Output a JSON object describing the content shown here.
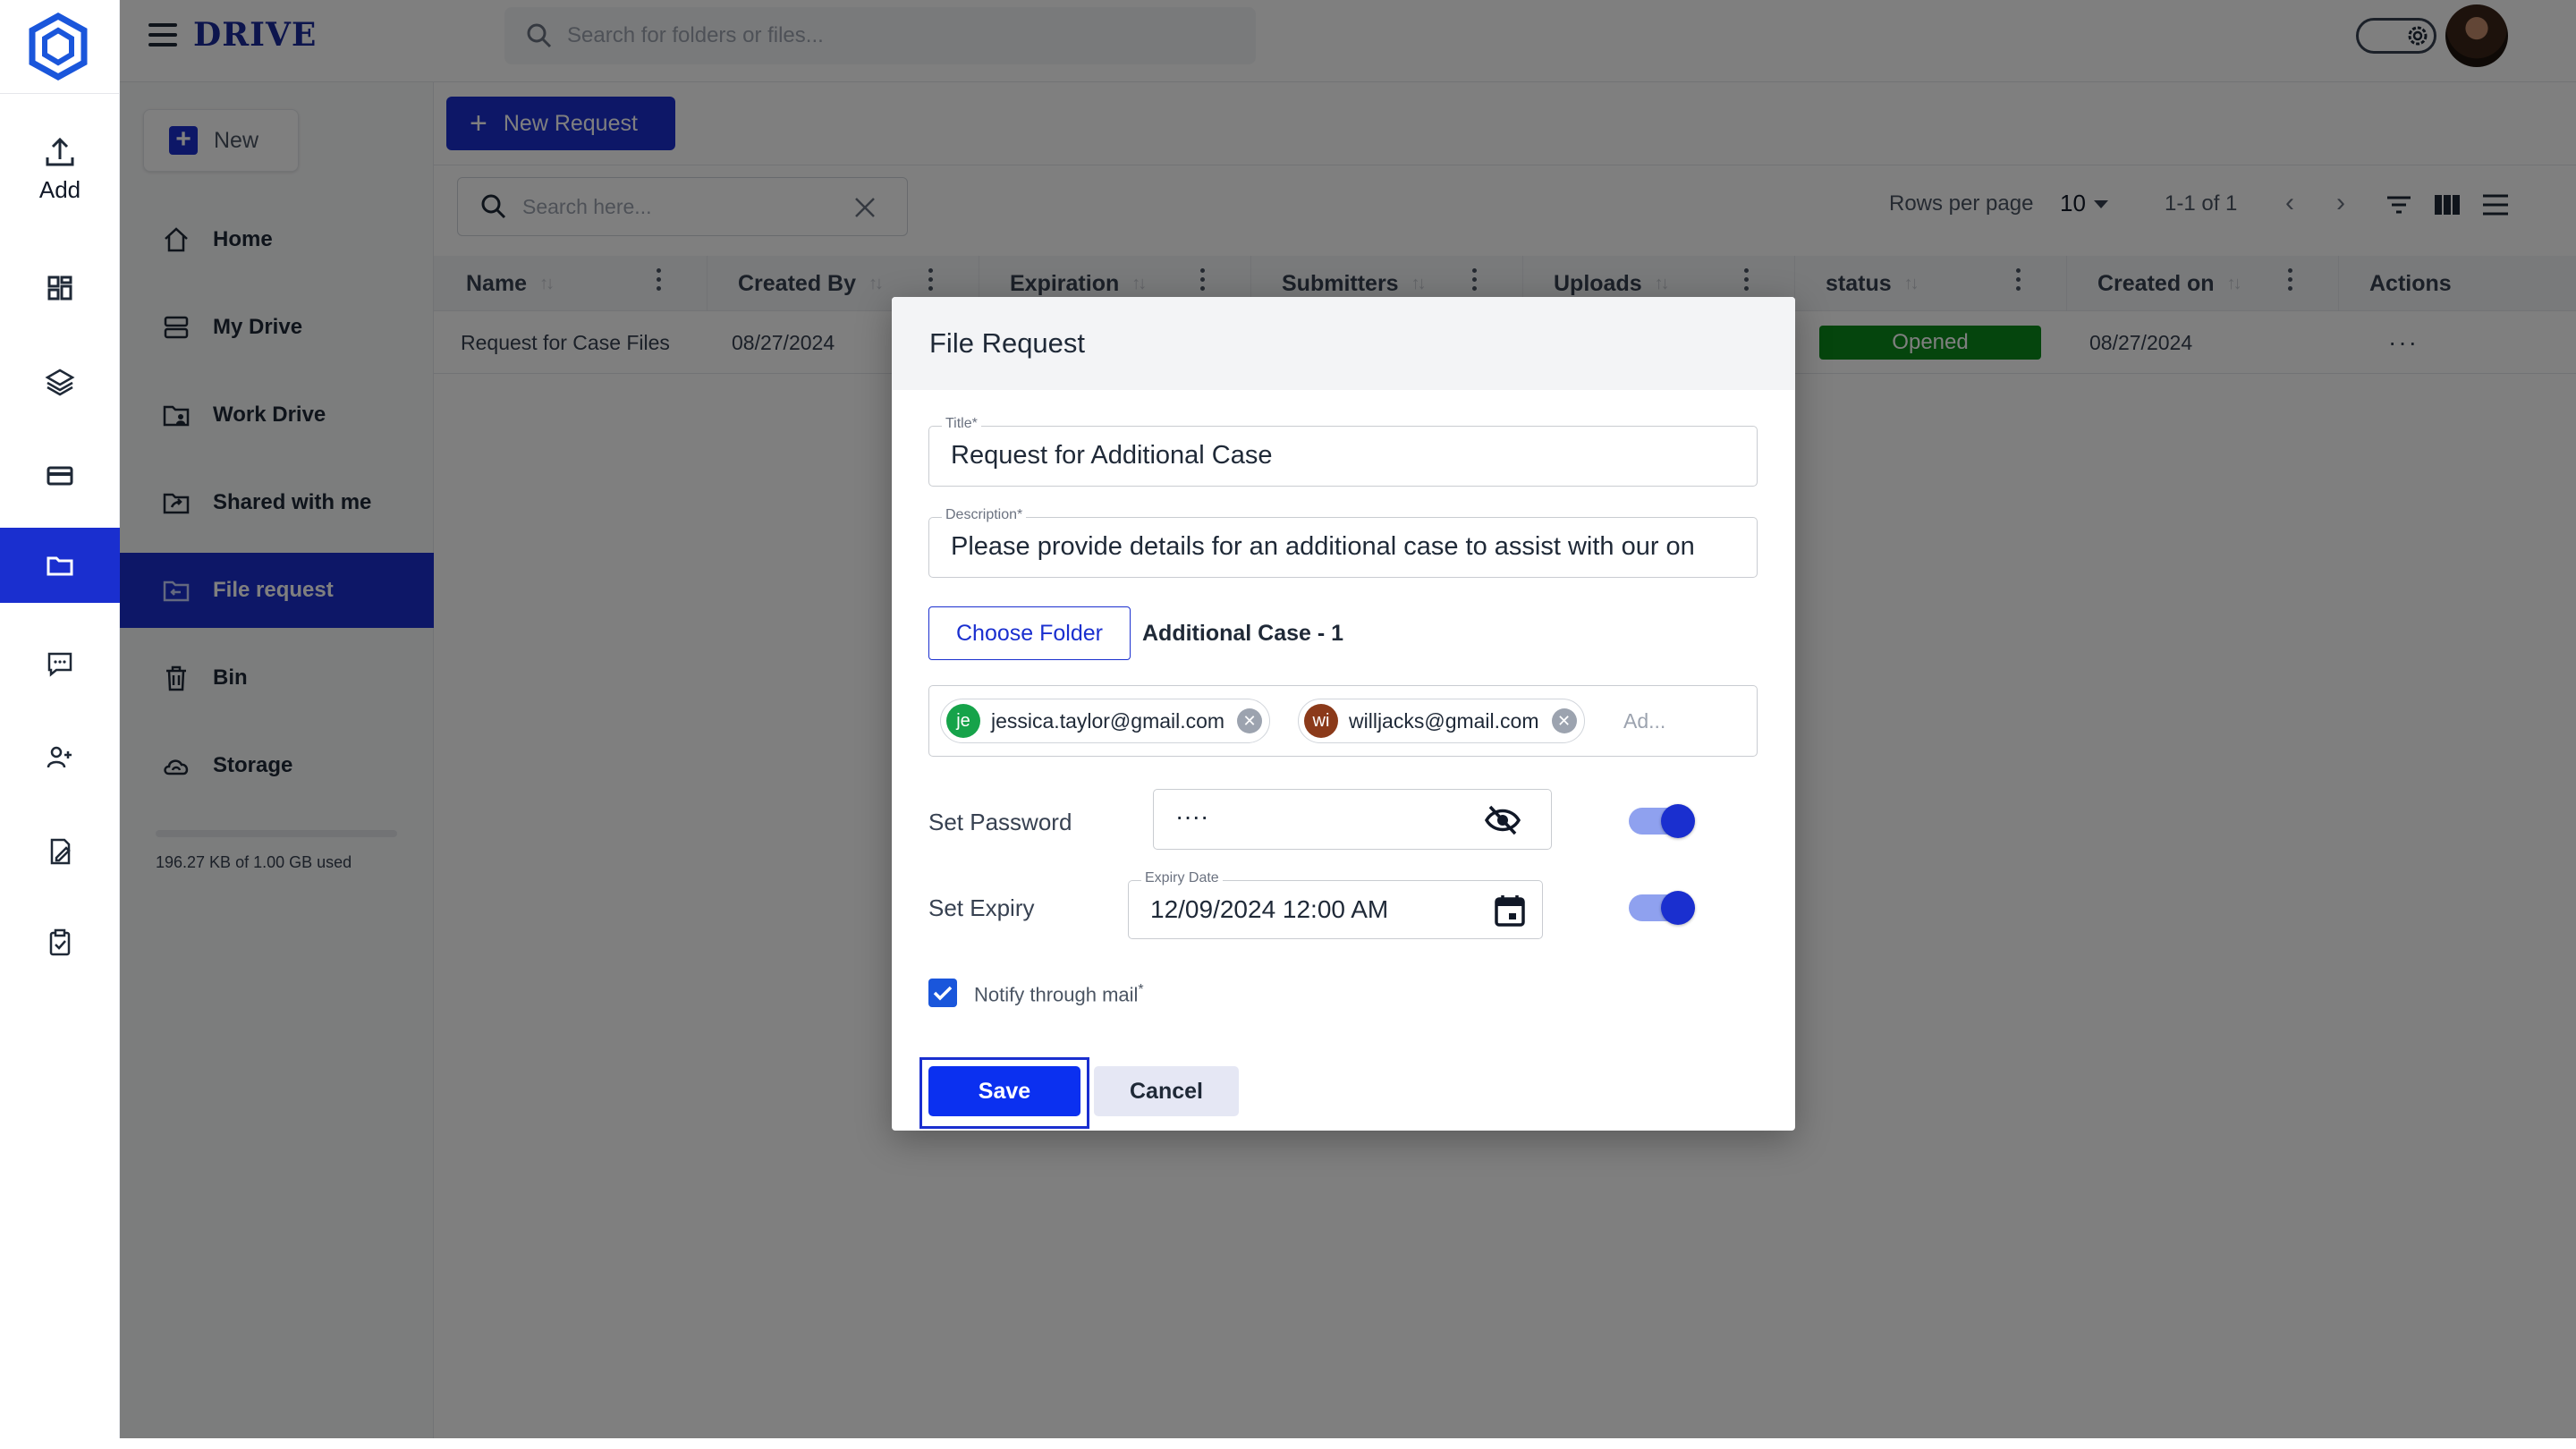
{
  "app": {
    "brand": "DRIVE",
    "search_placeholder": "Search for folders or files...",
    "add_label": "Add"
  },
  "sidebar": {
    "new_label": "New",
    "items": [
      {
        "label": "Home",
        "icon": "home-icon"
      },
      {
        "label": "My Drive",
        "icon": "drive-icon"
      },
      {
        "label": "Work Drive",
        "icon": "work-folder-icon"
      },
      {
        "label": "Shared with me",
        "icon": "shared-folder-icon"
      },
      {
        "label": "File request",
        "icon": "file-request-icon",
        "active": true
      },
      {
        "label": "Bin",
        "icon": "trash-icon"
      },
      {
        "label": "Storage",
        "icon": "cloud-icon"
      }
    ],
    "storage_text": "196.27 KB of 1.00 GB used"
  },
  "toolbar": {
    "new_request_label": "New Request",
    "search_placeholder": "Search here...",
    "rows_per_page_label": "Rows per page",
    "rows_per_page_value": "10",
    "page_info": "1-1 of 1"
  },
  "table": {
    "columns": [
      "Name",
      "Created By",
      "Expiration",
      "Submitters",
      "Uploads",
      "status",
      "Created on",
      "Actions"
    ],
    "rows": [
      {
        "name": "Request for Case Files",
        "created_by": "08/27/2024",
        "status": "Opened",
        "created_on": "08/27/2024",
        "actions": "···"
      }
    ]
  },
  "modal": {
    "title": "File Request",
    "title_field_label": "Title*",
    "title_value": "Request for Additional Case",
    "description_label": "Description*",
    "description_value": "Please provide details for an additional case to assist with our on",
    "choose_folder_label": "Choose Folder",
    "folder_name": "Additional Case - 1",
    "recipients": [
      {
        "initials": "je",
        "email": "jessica.taylor@gmail.com",
        "color": "#16a34a"
      },
      {
        "initials": "wi",
        "email": "willjacks@gmail.com",
        "color": "#8b3a1a"
      }
    ],
    "recipient_placeholder": "Ad...",
    "set_password_label": "Set Password",
    "password_value": "····",
    "set_expiry_label": "Set Expiry",
    "expiry_label": "Expiry Date",
    "expiry_value": "12/09/2024 12:00 AM",
    "notify_label": "Notify through mail",
    "notify_required": "*",
    "save_label": "Save",
    "cancel_label": "Cancel"
  },
  "colors": {
    "primary": "#1a2fcf",
    "status_opened": "#0b8a1a"
  }
}
